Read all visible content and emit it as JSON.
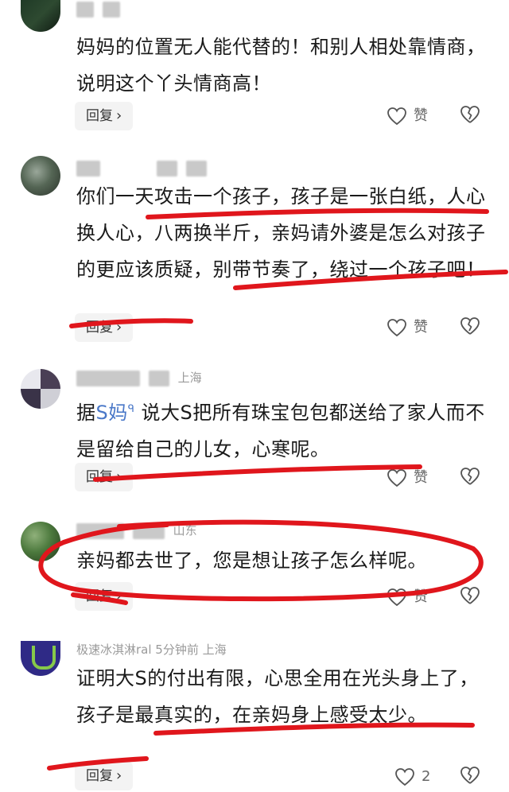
{
  "comments": [
    {
      "meta": "",
      "text": "妈妈的位置无人能代替的！和别人相处靠情商，说明这个丫头情商高！",
      "reply_label": "回复",
      "like_label": "赞"
    },
    {
      "meta": "",
      "text": "你们一天攻击一个孩子，孩子是一张白纸，人心换人心，八两换半斤，亲妈请外婆是怎么对孩子的更应该质疑，别带节奏了，绕过一个孩子吧！",
      "reply_label": "回复",
      "like_label": "赞"
    },
    {
      "meta": "上海",
      "text_prefix": "据",
      "mention": "S妈",
      "text_suffix": " 说大S把所有珠宝包包都送给了家人而不是留给自己的儿女，心寒呢。",
      "reply_label": "回复",
      "like_label": "赞"
    },
    {
      "meta": "山东",
      "text": "亲妈都去世了，您是想让孩子怎么样呢。",
      "reply_label": "回复",
      "like_label": "赞"
    },
    {
      "meta": "极速冰淇淋ral  5分钟前  上海",
      "text": "证明大S的付出有限，心思全用在光头身上了，孩子是最真实的，在亲妈身上感受太少。",
      "reply_label": "回复",
      "like_count": "2"
    }
  ],
  "colors": {
    "annotation": "#e0161c",
    "mention": "#4a78c8"
  }
}
